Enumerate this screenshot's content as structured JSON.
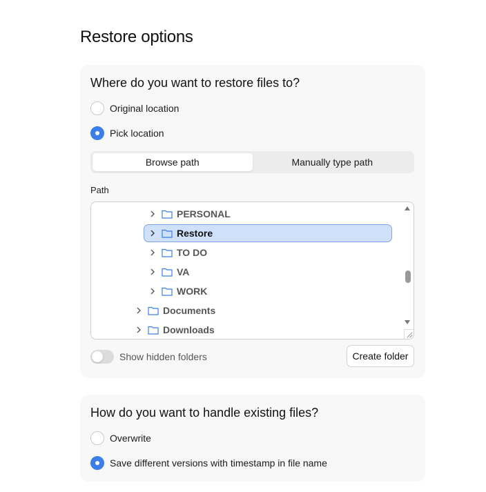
{
  "page": {
    "title": "Restore options"
  },
  "location_card": {
    "title": "Where do you want to restore files to?",
    "options": [
      {
        "label": "Original location",
        "selected": false
      },
      {
        "label": "Pick location",
        "selected": true
      }
    ],
    "tabs": [
      {
        "label": "Browse path",
        "active": true
      },
      {
        "label": "Manually type path",
        "active": false
      }
    ],
    "path_label": "Path",
    "tree_items": [
      {
        "label": "PERSONAL",
        "selected": false,
        "icon": "folder-icon"
      },
      {
        "label": "Restore",
        "selected": true,
        "icon": "folder-icon"
      },
      {
        "label": "TO DO",
        "selected": false,
        "icon": "folder-icon"
      },
      {
        "label": "VA",
        "selected": false,
        "icon": "folder-icon"
      },
      {
        "label": "WORK",
        "selected": false,
        "icon": "folder-icon"
      },
      {
        "label": "Documents",
        "selected": false,
        "icon": "folder-icon"
      },
      {
        "label": "Downloads",
        "selected": false,
        "icon": "folder-icon"
      }
    ],
    "show_hidden_label": "Show hidden folders",
    "show_hidden_on": false,
    "create_folder_label": "Create folder"
  },
  "existing_card": {
    "title": "How do you want to handle existing files?",
    "options": [
      {
        "label": "Overwrite",
        "selected": false
      },
      {
        "label": "Save different versions with timestamp in file name",
        "selected": true
      }
    ]
  },
  "colors": {
    "accent": "#3b7ee8",
    "selection_bg": "#cfe0fb",
    "card_bg": "#f8f8f8"
  }
}
